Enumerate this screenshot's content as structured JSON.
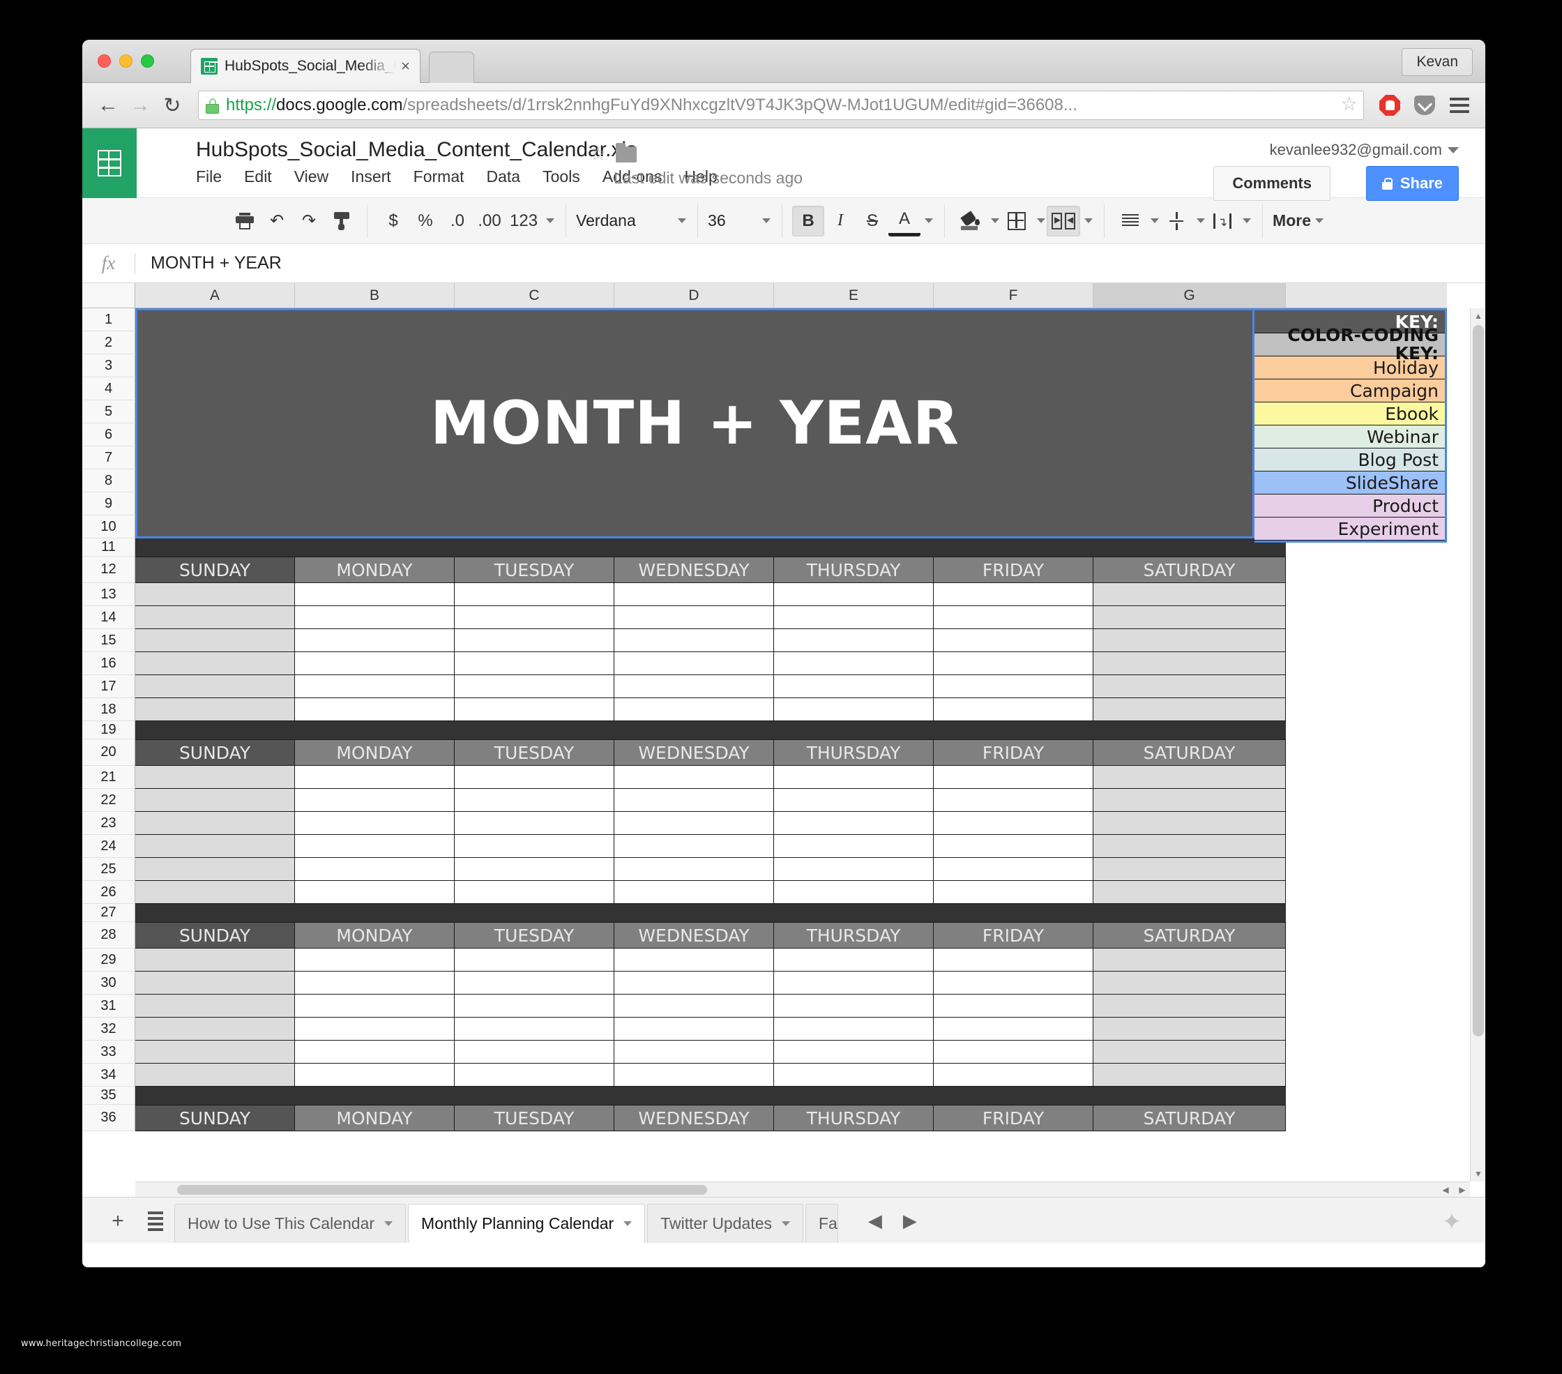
{
  "browser": {
    "tab_title": "HubSpots_Social_Media_C",
    "tab_close_glyph": "×",
    "profile_name": "Kevan",
    "back_glyph": "←",
    "forward_glyph": "→",
    "reload_glyph": "↻",
    "star_glyph": "☆",
    "url": {
      "scheme": "https://",
      "host": "docs.google.com",
      "path": "/spreadsheets/d/1rrsk2nnhgFuYd9XNhxcgzltV9T4JK3pQW-MJot1UGUM/edit#gid=36608..."
    },
    "extensions": [
      "adblock-icon",
      "pocket-icon",
      "hamburger-menu-icon"
    ]
  },
  "docs": {
    "title": "HubSpots_Social_Media_Content_Calendar.xls",
    "menus": [
      "File",
      "Edit",
      "View",
      "Insert",
      "Format",
      "Data",
      "Tools",
      "Add-ons",
      "Help"
    ],
    "last_edit": "Last edit was seconds ago",
    "account_email": "kevanlee932@gmail.com",
    "comments_label": "Comments",
    "share_label": "Share"
  },
  "toolbar": {
    "currency_label": "$",
    "percent_label": "%",
    "decrease_decimal_label": ".0",
    "increase_decimal_label": ".00",
    "number_format_label": "123",
    "font_name": "Verdana",
    "font_size": "36",
    "bold_label": "B",
    "italic_label": "I",
    "strikethrough_label": "S",
    "text_color_label": "A",
    "more_label": "More"
  },
  "formula_bar": {
    "fx_label": "fx",
    "value": "MONTH + YEAR"
  },
  "grid": {
    "columns": [
      "A",
      "B",
      "C",
      "D",
      "E",
      "F",
      "G"
    ],
    "selected_column": "G",
    "row_numbers": [
      1,
      2,
      3,
      4,
      5,
      6,
      7,
      8,
      9,
      10,
      11,
      12,
      13,
      14,
      15,
      16,
      17,
      18,
      19,
      20,
      21,
      22,
      23,
      24,
      25,
      26,
      27,
      28,
      29,
      30,
      31,
      32,
      33,
      34,
      35,
      36
    ],
    "banner_text": "MONTH + YEAR",
    "banner_bg": "#595959",
    "selection_border": "#4a86e8",
    "key_title": "KEY:",
    "key_subtitle_line1": "COLOR-CODING",
    "key_subtitle_line2": "KEY:",
    "key_items": [
      {
        "label": "Holiday",
        "color": "#fbcc9c"
      },
      {
        "label": "Campaign",
        "color": "#fbcc9c"
      },
      {
        "label": "Ebook",
        "color": "#fbf8a0"
      },
      {
        "label": "Webinar",
        "color": "#dfeee0"
      },
      {
        "label": "Blog Post",
        "color": "#d7e6e8"
      },
      {
        "label": "SlideShare",
        "color": "#9dc1f7"
      },
      {
        "label": "Product",
        "color": "#e8cfe8"
      },
      {
        "label": "Experiment",
        "color": "#e8cfe8"
      }
    ],
    "day_headers": [
      "SUNDAY",
      "MONDAY",
      "TUESDAY",
      "WEDNESDAY",
      "THURSDAY",
      "FRIDAY",
      "SATURDAY"
    ],
    "week_header_rows": [
      12,
      20,
      28,
      36
    ],
    "spacer_rows": [
      11,
      19,
      27,
      35
    ],
    "spacer_color": "#333333",
    "sunday_header_color": "#555555",
    "day_header_color": "#808080",
    "sunday_cell_color": "#dcdcdc"
  },
  "sheet_bar": {
    "add_sheet_glyph": "+",
    "all_sheets_icon": "sheet-list-icon",
    "tabs": [
      {
        "label": "How to Use This Calendar",
        "active": false
      },
      {
        "label": "Monthly Planning Calendar",
        "active": true
      },
      {
        "label": "Twitter Updates",
        "active": false
      },
      {
        "label": "Fa",
        "active": false
      }
    ],
    "prev_glyph": "◀",
    "next_glyph": "▶",
    "explore_glyph": "✦"
  },
  "watermark": "www.heritagechristiancollege.com"
}
